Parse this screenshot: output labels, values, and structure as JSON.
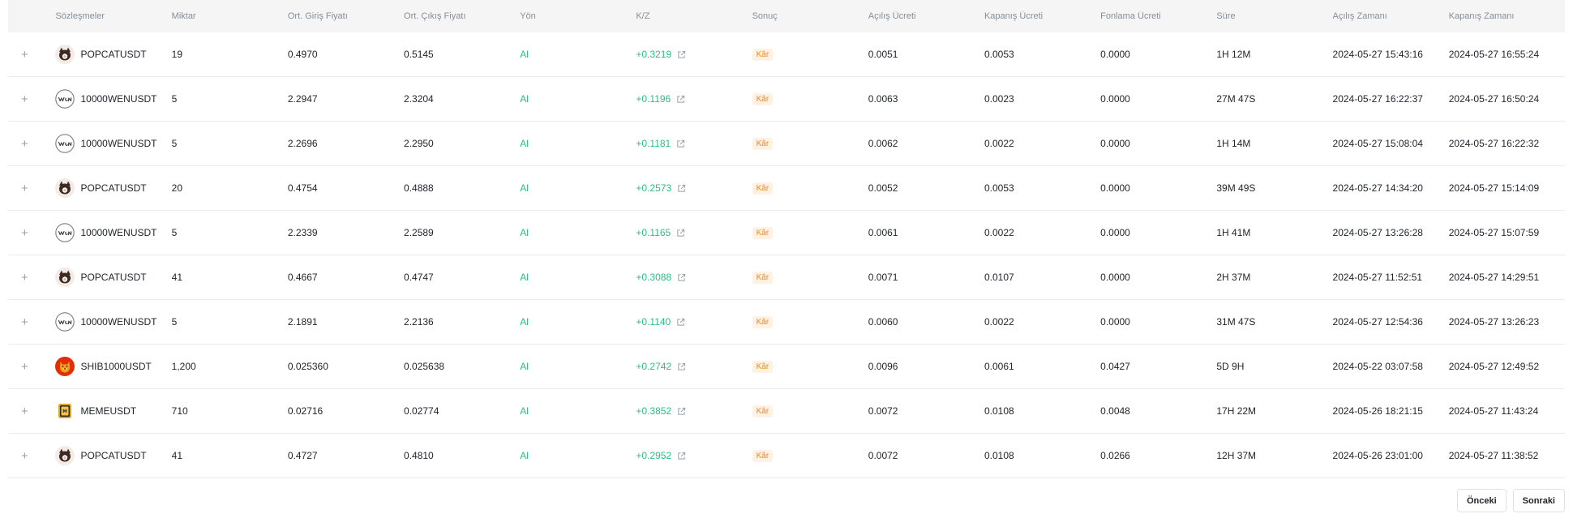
{
  "table": {
    "headers": {
      "symbol": "Sözleşmeler",
      "qty": "Miktar",
      "avg_in": "Ort. Giriş Fiyatı",
      "avg_out": "Ort. Çıkış Fiyatı",
      "dir": "Yön",
      "pnl": "K/Z",
      "result": "Sonuç",
      "open_fee": "Açılış Ücreti",
      "close_fee": "Kapanış Ücreti",
      "funding_fee": "Fonlama Ücreti",
      "duration": "Süre",
      "open_time": "Açılış Zamanı",
      "close_time": "Kapanış Zamanı"
    },
    "expand_glyph": "+",
    "rows": [
      {
        "icon": "popcat",
        "symbol": "POPCATUSDT",
        "qty": "19",
        "avg_in": "0.4970",
        "avg_out": "0.5145",
        "dir": "Al",
        "pnl": "+0.3219",
        "result": "Kâr",
        "open_fee": "0.0051",
        "close_fee": "0.0053",
        "funding_fee": "0.0000",
        "duration": "1H 12M",
        "open_time": "2024-05-27 15:43:16",
        "close_time": "2024-05-27 16:55:24"
      },
      {
        "icon": "wen",
        "symbol": "10000WENUSDT",
        "qty": "5",
        "avg_in": "2.2947",
        "avg_out": "2.3204",
        "dir": "Al",
        "pnl": "+0.1196",
        "result": "Kâr",
        "open_fee": "0.0063",
        "close_fee": "0.0023",
        "funding_fee": "0.0000",
        "duration": "27M 47S",
        "open_time": "2024-05-27 16:22:37",
        "close_time": "2024-05-27 16:50:24"
      },
      {
        "icon": "wen",
        "symbol": "10000WENUSDT",
        "qty": "5",
        "avg_in": "2.2696",
        "avg_out": "2.2950",
        "dir": "Al",
        "pnl": "+0.1181",
        "result": "Kâr",
        "open_fee": "0.0062",
        "close_fee": "0.0022",
        "funding_fee": "0.0000",
        "duration": "1H 14M",
        "open_time": "2024-05-27 15:08:04",
        "close_time": "2024-05-27 16:22:32"
      },
      {
        "icon": "popcat",
        "symbol": "POPCATUSDT",
        "qty": "20",
        "avg_in": "0.4754",
        "avg_out": "0.4888",
        "dir": "Al",
        "pnl": "+0.2573",
        "result": "Kâr",
        "open_fee": "0.0052",
        "close_fee": "0.0053",
        "funding_fee": "0.0000",
        "duration": "39M 49S",
        "open_time": "2024-05-27 14:34:20",
        "close_time": "2024-05-27 15:14:09"
      },
      {
        "icon": "wen",
        "symbol": "10000WENUSDT",
        "qty": "5",
        "avg_in": "2.2339",
        "avg_out": "2.2589",
        "dir": "Al",
        "pnl": "+0.1165",
        "result": "Kâr",
        "open_fee": "0.0061",
        "close_fee": "0.0022",
        "funding_fee": "0.0000",
        "duration": "1H 41M",
        "open_time": "2024-05-27 13:26:28",
        "close_time": "2024-05-27 15:07:59"
      },
      {
        "icon": "popcat",
        "symbol": "POPCATUSDT",
        "qty": "41",
        "avg_in": "0.4667",
        "avg_out": "0.4747",
        "dir": "Al",
        "pnl": "+0.3088",
        "result": "Kâr",
        "open_fee": "0.0071",
        "close_fee": "0.0107",
        "funding_fee": "0.0000",
        "duration": "2H 37M",
        "open_time": "2024-05-27 11:52:51",
        "close_time": "2024-05-27 14:29:51"
      },
      {
        "icon": "wen",
        "symbol": "10000WENUSDT",
        "qty": "5",
        "avg_in": "2.1891",
        "avg_out": "2.2136",
        "dir": "Al",
        "pnl": "+0.1140",
        "result": "Kâr",
        "open_fee": "0.0060",
        "close_fee": "0.0022",
        "funding_fee": "0.0000",
        "duration": "31M 47S",
        "open_time": "2024-05-27 12:54:36",
        "close_time": "2024-05-27 13:26:23"
      },
      {
        "icon": "shib",
        "symbol": "SHIB1000USDT",
        "qty": "1,200",
        "avg_in": "0.025360",
        "avg_out": "0.025638",
        "dir": "Al",
        "pnl": "+0.2742",
        "result": "Kâr",
        "open_fee": "0.0096",
        "close_fee": "0.0061",
        "funding_fee": "0.0427",
        "duration": "5D 9H",
        "open_time": "2024-05-22 03:07:58",
        "close_time": "2024-05-27 12:49:52"
      },
      {
        "icon": "meme",
        "symbol": "MEMEUSDT",
        "qty": "710",
        "avg_in": "0.02716",
        "avg_out": "0.02774",
        "dir": "Al",
        "pnl": "+0.3852",
        "result": "Kâr",
        "open_fee": "0.0072",
        "close_fee": "0.0108",
        "funding_fee": "0.0048",
        "duration": "17H 22M",
        "open_time": "2024-05-26 18:21:15",
        "close_time": "2024-05-27 11:43:24"
      },
      {
        "icon": "popcat",
        "symbol": "POPCATUSDT",
        "qty": "41",
        "avg_in": "0.4727",
        "avg_out": "0.4810",
        "dir": "Al",
        "pnl": "+0.2952",
        "result": "Kâr",
        "open_fee": "0.0072",
        "close_fee": "0.0108",
        "funding_fee": "0.0266",
        "duration": "12H 37M",
        "open_time": "2024-05-26 23:01:00",
        "close_time": "2024-05-27 11:38:52"
      }
    ]
  },
  "pagination": {
    "prev_label": "Önceki",
    "next_label": "Sonraki"
  },
  "colors": {
    "profit_green": "#2ebd85",
    "badge_bg": "#fff1e3",
    "badge_text": "#f0891e",
    "header_bg": "#f5f5f5",
    "muted_text": "#848e9c"
  }
}
